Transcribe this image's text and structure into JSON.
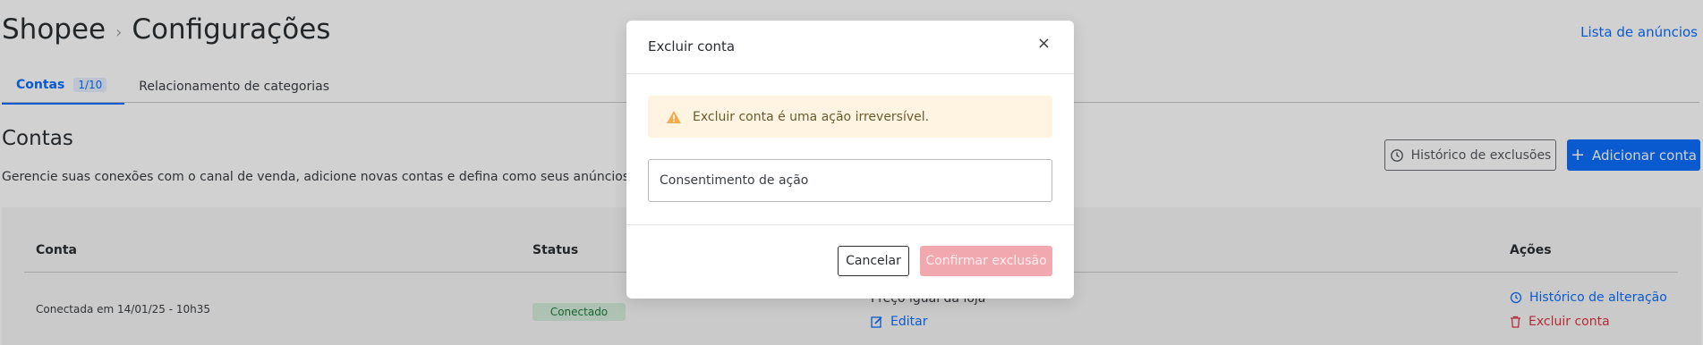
{
  "header": {
    "breadcrumb_root": "Shopee",
    "breadcrumb_sep": "›",
    "breadcrumb_current": "Configurações",
    "top_link": "Lista de anúncios"
  },
  "tabs": [
    {
      "label": "Contas",
      "count": "1/10",
      "active": true
    },
    {
      "label": "Relacionamento de categorias",
      "active": false
    }
  ],
  "section": {
    "title": "Contas",
    "description": "Gerencie suas conexões com o canal de venda, adicione novas contas e defina como seus anúncios serão precificados."
  },
  "actions": {
    "history_button": "Histórico de exclusões",
    "add_button": "Adicionar conta"
  },
  "table": {
    "headers": [
      "Conta",
      "Status",
      "Ações"
    ],
    "row": {
      "connected_at": "Conectada em 14/01/25 - 10h35",
      "status": "Conectado",
      "pricing": "Preço igual da loja",
      "edit": "Editar",
      "history_link": "Histórico de alteração",
      "delete_link": "Excluir conta"
    }
  },
  "modal": {
    "title": "Excluir conta",
    "close": "×",
    "alert": "Excluir conta é uma ação irreversível.",
    "input_placeholder": "Consentimento de ação",
    "cancel": "Cancelar",
    "confirm": "Confirmar exclusão"
  },
  "colors": {
    "primary": "#0d6efd",
    "danger": "#dc3545",
    "success_bg": "#d4edda",
    "warning_bg": "#fff4e1",
    "disabled_confirm": "#f2a8af"
  }
}
